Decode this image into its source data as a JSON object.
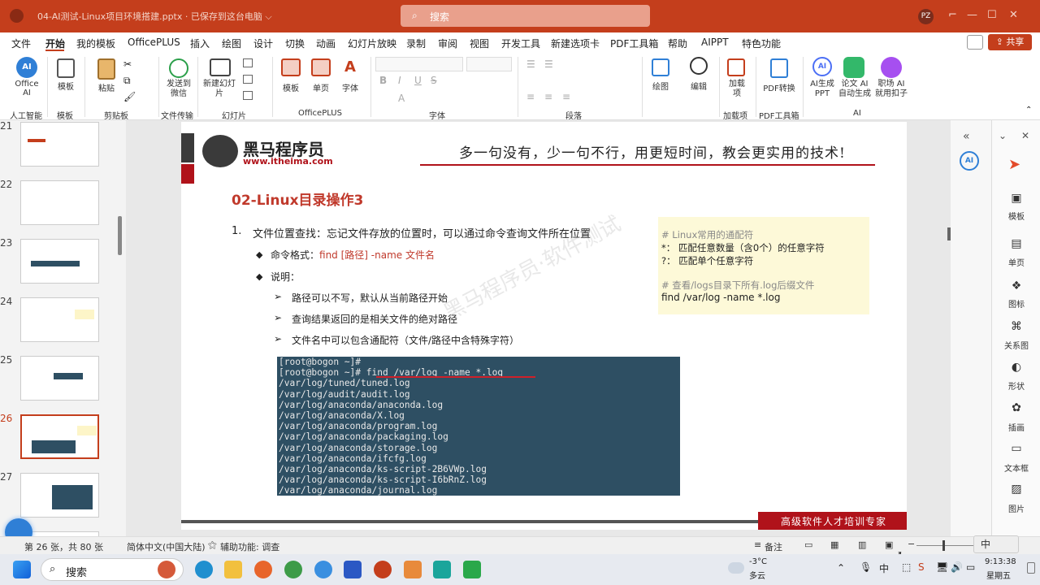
{
  "titlebar": {
    "document": "04-AI测试-Linux项目环境搭建.pptx · 已保存到这台电脑 ⌵",
    "search_placeholder": "搜索",
    "user_initials": "PZ"
  },
  "menu": {
    "items": [
      "文件",
      "开始",
      "我的模板",
      "OfficePLUS",
      "插入",
      "绘图",
      "设计",
      "切换",
      "动画",
      "幻灯片放映",
      "录制",
      "审阅",
      "视图",
      "开发工具",
      "新建选项卡",
      "PDF工具箱",
      "帮助",
      "AIPPT",
      "特色功能"
    ],
    "share": "共享"
  },
  "ribbon": {
    "office_ai": "Office AI",
    "group_ai": "人工智能",
    "template": "模板",
    "group_template": "模板",
    "paste": "粘贴",
    "group_clipboard": "剪贴板",
    "send_wechat": "发送到微信",
    "group_filetransfer": "文件传输",
    "new_slide": "新建幻灯片",
    "group_slides": "幻灯片",
    "template2": "模板",
    "single_page": "单页",
    "font_btn": "字体",
    "group_officeplus": "OfficePLUS",
    "group_font": "字体",
    "group_paragraph": "段落",
    "draw": "绘图",
    "edit": "编辑",
    "addin": "加载项",
    "group_addin": "加载项",
    "pdf_convert": "PDF转换",
    "group_pdf": "PDF工具箱",
    "ai_ppt": "AI生成PPT",
    "paper_ai": "论文 AI 自动生成",
    "workplace_ai": "职场 AI 就用扣子",
    "group_ai2": "AI"
  },
  "thumbnails": {
    "numbers": [
      "21",
      "22",
      "23",
      "24",
      "25",
      "26",
      "27"
    ],
    "selected": "26"
  },
  "slide": {
    "brand_name": "黑马程序员",
    "brand_url": "www.itheima.com",
    "slogan": "多一句没有，少一句不行，用更短时间，教会更实用的技术!",
    "heading": "02-Linux目录操作3",
    "item_number": "1.",
    "item_text": "文件位置查找：忘记文件存放的位置时，可以通过命令查询文件所在位置",
    "cmd_label": "命令格式：",
    "cmd_format": "find [路径] -name 文件名",
    "explain_label": "说明：",
    "notes": [
      "路径可以不写，默认从当前路径开始",
      "查询结果返回的是相关文件的绝对路径",
      "文件名中可以包含通配符（文件/路径中含特殊字符）"
    ],
    "tip": {
      "line1": "# Linux常用的通配符",
      "line2": "*：  匹配任意数量（含0个）的任意字符",
      "line3": "?：  匹配单个任意字符",
      "line4": "# 查看/logs目录下所有.log后缀文件",
      "line5": "find  /var/log  -name  *.log"
    },
    "terminal": [
      "[root@bogon ~]#",
      "[root@bogon ~]# find /var/log -name *.log",
      "/var/log/tuned/tuned.log",
      "/var/log/audit/audit.log",
      "/var/log/anaconda/anaconda.log",
      "/var/log/anaconda/X.log",
      "/var/log/anaconda/program.log",
      "/var/log/anaconda/packaging.log",
      "/var/log/anaconda/storage.log",
      "/var/log/anaconda/ifcfg.log",
      "/var/log/anaconda/ks-script-2B6VWp.log",
      "/var/log/anaconda/ks-script-I6bRnZ.log",
      "/var/log/anaconda/journal.log"
    ],
    "footer": "高级软件人才培训专家",
    "watermark": "黑马程序员·软件测试"
  },
  "sidepanel": {
    "items": [
      "模板",
      "单页",
      "图标",
      "关系图",
      "形状",
      "插画",
      "文本框",
      "图片"
    ]
  },
  "status": {
    "slide_count": "第 26 张，共 80 张",
    "language": "简体中文(中国大陆)",
    "accessibility": "辅助功能: 调查",
    "notes": "备注"
  },
  "taskbar": {
    "search": "搜索",
    "weather_temp": "-3°C",
    "weather_desc": "多云",
    "time": "9:13:38",
    "day": "星期五",
    "ime": "中"
  },
  "colors": {
    "brand": "#c43e1c",
    "heading": "#c0392b",
    "term_bg": "#2e4f63"
  }
}
